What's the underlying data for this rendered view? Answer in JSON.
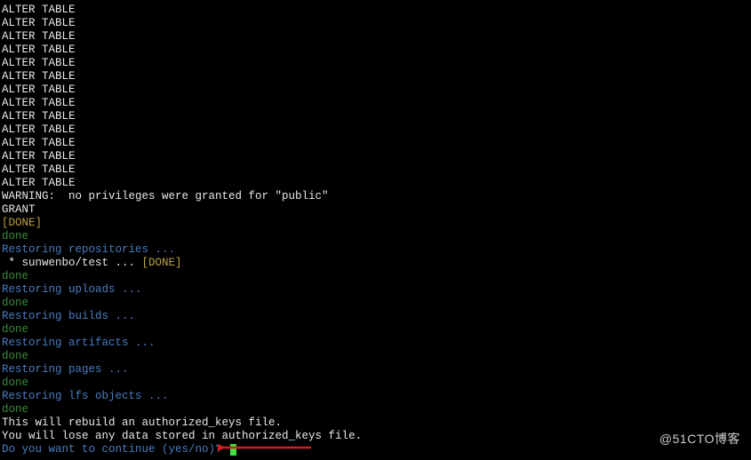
{
  "lines": [
    {
      "text": "ALTER TABLE",
      "cls": "white"
    },
    {
      "text": "ALTER TABLE",
      "cls": "white"
    },
    {
      "text": "ALTER TABLE",
      "cls": "white"
    },
    {
      "text": "ALTER TABLE",
      "cls": "white"
    },
    {
      "text": "ALTER TABLE",
      "cls": "white"
    },
    {
      "text": "ALTER TABLE",
      "cls": "white"
    },
    {
      "text": "ALTER TABLE",
      "cls": "white"
    },
    {
      "text": "ALTER TABLE",
      "cls": "white"
    },
    {
      "text": "ALTER TABLE",
      "cls": "white"
    },
    {
      "text": "ALTER TABLE",
      "cls": "white"
    },
    {
      "text": "ALTER TABLE",
      "cls": "white"
    },
    {
      "text": "ALTER TABLE",
      "cls": "white"
    },
    {
      "text": "ALTER TABLE",
      "cls": "white"
    },
    {
      "text": "ALTER TABLE",
      "cls": "white"
    },
    {
      "text": "WARNING:  no privileges were granted for \"public\"",
      "cls": "white"
    },
    {
      "text": "GRANT",
      "cls": "white"
    },
    {
      "text": "[DONE]",
      "cls": "yellow"
    },
    {
      "text": "done",
      "cls": "green"
    },
    {
      "text": "Restoring repositories ...",
      "cls": "blue"
    },
    {
      "segments": [
        {
          "text": " * sunwenbo/test ... ",
          "cls": "white"
        },
        {
          "text": "[DONE]",
          "cls": "yellow"
        }
      ]
    },
    {
      "text": "done",
      "cls": "green"
    },
    {
      "text": "Restoring uploads ...",
      "cls": "blue"
    },
    {
      "text": "done",
      "cls": "green"
    },
    {
      "text": "Restoring builds ...",
      "cls": "blue"
    },
    {
      "text": "done",
      "cls": "green"
    },
    {
      "text": "Restoring artifacts ...",
      "cls": "blue"
    },
    {
      "text": "done",
      "cls": "green"
    },
    {
      "text": "Restoring pages ...",
      "cls": "blue"
    },
    {
      "text": "done",
      "cls": "green"
    },
    {
      "text": "Restoring lfs objects ...",
      "cls": "blue"
    },
    {
      "text": "done",
      "cls": "green"
    },
    {
      "text": "This will rebuild an authorized_keys file.",
      "cls": "white"
    },
    {
      "text": "You will lose any data stored in authorized_keys file.",
      "cls": "white"
    },
    {
      "segments": [
        {
          "text": "Do you want to continue (yes/no)? ",
          "cls": "blue"
        }
      ],
      "cursor": true
    }
  ],
  "watermark": "@51CTO博客"
}
